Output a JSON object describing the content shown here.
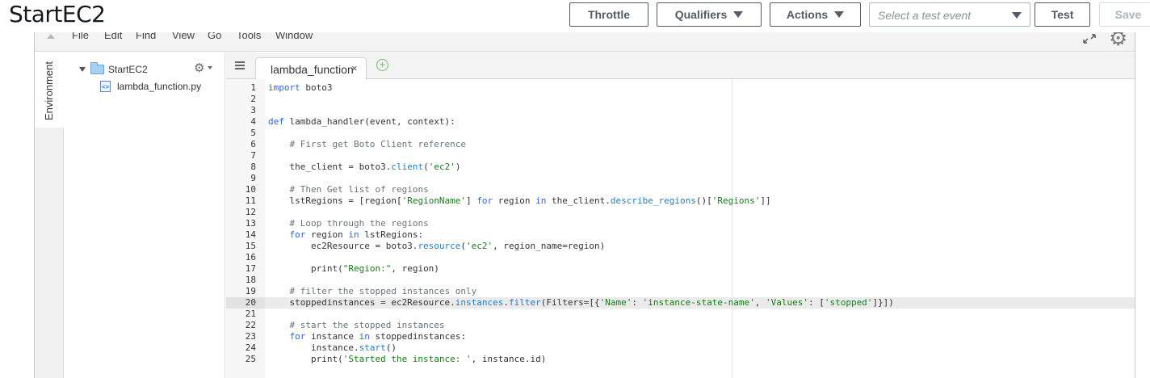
{
  "header": {
    "title": "StartEC2",
    "throttle_label": "Throttle",
    "qualifiers_label": "Qualifiers",
    "actions_label": "Actions",
    "test_event_placeholder": "Select a test event",
    "test_label": "Test",
    "save_label": "Save"
  },
  "menu": {
    "items": [
      "File",
      "Edit",
      "Find",
      "View",
      "Go",
      "Tools",
      "Window"
    ]
  },
  "rail": {
    "environment_label": "Environment"
  },
  "tree": {
    "folder": "StartEC2",
    "file": "lambda_function.py"
  },
  "editor": {
    "tab_label": "lambda_function",
    "tab_close": "×",
    "add_tab": "+",
    "active_line": 20,
    "lines": [
      {
        "n": "1",
        "code": "import boto3"
      },
      {
        "n": "2",
        "code": ""
      },
      {
        "n": "3",
        "code": ""
      },
      {
        "n": "4",
        "code": "def lambda_handler(event, context):"
      },
      {
        "n": "5",
        "code": ""
      },
      {
        "n": "6",
        "code": "    # First get Boto Client reference"
      },
      {
        "n": "7",
        "code": ""
      },
      {
        "n": "8",
        "code": "    the_client = boto3.client('ec2')"
      },
      {
        "n": "9",
        "code": ""
      },
      {
        "n": "10",
        "code": "    # Then Get list of regions"
      },
      {
        "n": "11",
        "code": "    lstRegions = [region['RegionName'] for region in the_client.describe_regions()['Regions']]"
      },
      {
        "n": "12",
        "code": ""
      },
      {
        "n": "13",
        "code": "    # Loop through the regions"
      },
      {
        "n": "14",
        "code": "    for region in lstRegions:"
      },
      {
        "n": "15",
        "code": "        ec2Resource = boto3.resource('ec2', region_name=region)"
      },
      {
        "n": "16",
        "code": ""
      },
      {
        "n": "17",
        "code": "        print(\"Region:\", region)"
      },
      {
        "n": "18",
        "code": ""
      },
      {
        "n": "19",
        "code": "    # filter the stopped instances only"
      },
      {
        "n": "20",
        "code": "    stoppedinstances = ec2Resource.instances.filter(Filters=[{'Name': 'instance-state-name', 'Values': ['stopped']}])"
      },
      {
        "n": "21",
        "code": ""
      },
      {
        "n": "22",
        "code": "    # start the stopped instances"
      },
      {
        "n": "23",
        "code": "    for instance in stoppedinstances:"
      },
      {
        "n": "24",
        "code": "        instance.start()"
      },
      {
        "n": "25",
        "code": "        print('Started the instance: ', instance.id)"
      }
    ]
  },
  "colors": {
    "keyword": "#3366cc",
    "string": "#1a7a1a",
    "comment": "#6a737d"
  }
}
